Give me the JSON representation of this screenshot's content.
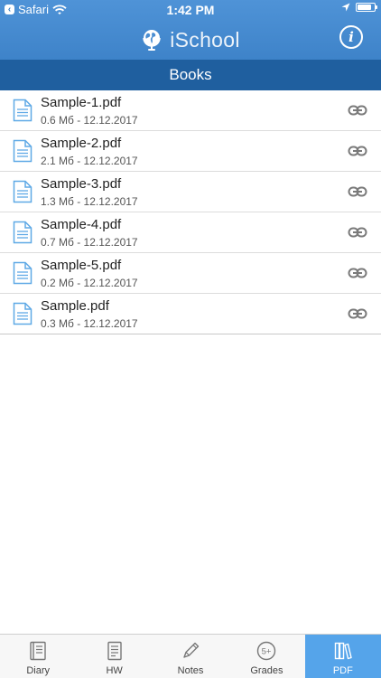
{
  "status_bar": {
    "back_app": "Safari",
    "time": "1:42 PM",
    "battery_level": 0.85
  },
  "header": {
    "app_name": "iSchool",
    "info_label": "i"
  },
  "section": {
    "title": "Books"
  },
  "files": [
    {
      "name": "Sample-1.pdf",
      "meta": "0.6 Мб - 12.12.2017"
    },
    {
      "name": "Sample-2.pdf",
      "meta": "2.1 Мб - 12.12.2017"
    },
    {
      "name": "Sample-3.pdf",
      "meta": "1.3 Мб - 12.12.2017"
    },
    {
      "name": "Sample-4.pdf",
      "meta": "0.7 Мб - 12.12.2017"
    },
    {
      "name": "Sample-5.pdf",
      "meta": "0.2 Мб - 12.12.2017"
    },
    {
      "name": "Sample.pdf",
      "meta": "0.3 Мб - 12.12.2017"
    }
  ],
  "tabs": [
    {
      "label": "Diary",
      "icon": "diary-icon"
    },
    {
      "label": "HW",
      "icon": "homework-icon"
    },
    {
      "label": "Notes",
      "icon": "pencil-icon"
    },
    {
      "label": "Grades",
      "icon": "grades-icon",
      "badge": "5+"
    },
    {
      "label": "PDF",
      "icon": "books-icon",
      "active": true
    }
  ],
  "colors": {
    "header": "#4a8ed2",
    "section_bar": "#1f5f9f",
    "active_tab": "#55a4ea",
    "file_icon": "#5fa9e6"
  }
}
